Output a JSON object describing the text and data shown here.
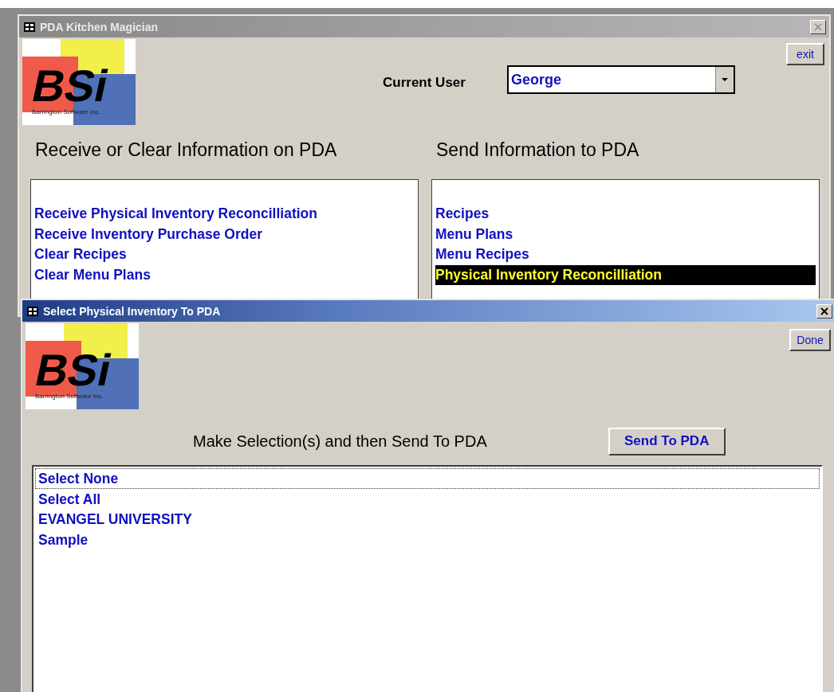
{
  "main_window": {
    "title": "PDA Kitchen Magician",
    "logo": {
      "mark": "BSi",
      "caption": "Barrington Software Inc."
    },
    "exit_button": "exit",
    "current_user": {
      "label": "Current User",
      "value": "George"
    },
    "receive_section": {
      "heading": "Receive or Clear Information on PDA",
      "items": [
        {
          "label": "Receive Physical Inventory Reconcilliation",
          "selected": false
        },
        {
          "label": "Receive Inventory Purchase Order",
          "selected": false
        },
        {
          "label": "Clear Recipes",
          "selected": false
        },
        {
          "label": "Clear Menu Plans",
          "selected": false
        }
      ]
    },
    "send_section": {
      "heading": "Send Information to PDA",
      "items": [
        {
          "label": "Recipes",
          "selected": false
        },
        {
          "label": "Menu Plans",
          "selected": false
        },
        {
          "label": "Menu Recipes",
          "selected": false
        },
        {
          "label": "Physical Inventory Reconcilliation",
          "selected": true
        }
      ]
    }
  },
  "dialog": {
    "title": "Select Physical Inventory To PDA",
    "logo": {
      "mark": "BSi",
      "caption": "Barrington Software Inc."
    },
    "done_button": "Done",
    "instruction": "Make Selection(s) and then Send To PDA",
    "send_button": "Send To PDA",
    "items": [
      {
        "label": "Select None",
        "selected": true
      },
      {
        "label": "Select All",
        "selected": false
      },
      {
        "label": "EVANGEL UNIVERSITY",
        "selected": false
      },
      {
        "label": "Sample",
        "selected": false
      }
    ]
  }
}
